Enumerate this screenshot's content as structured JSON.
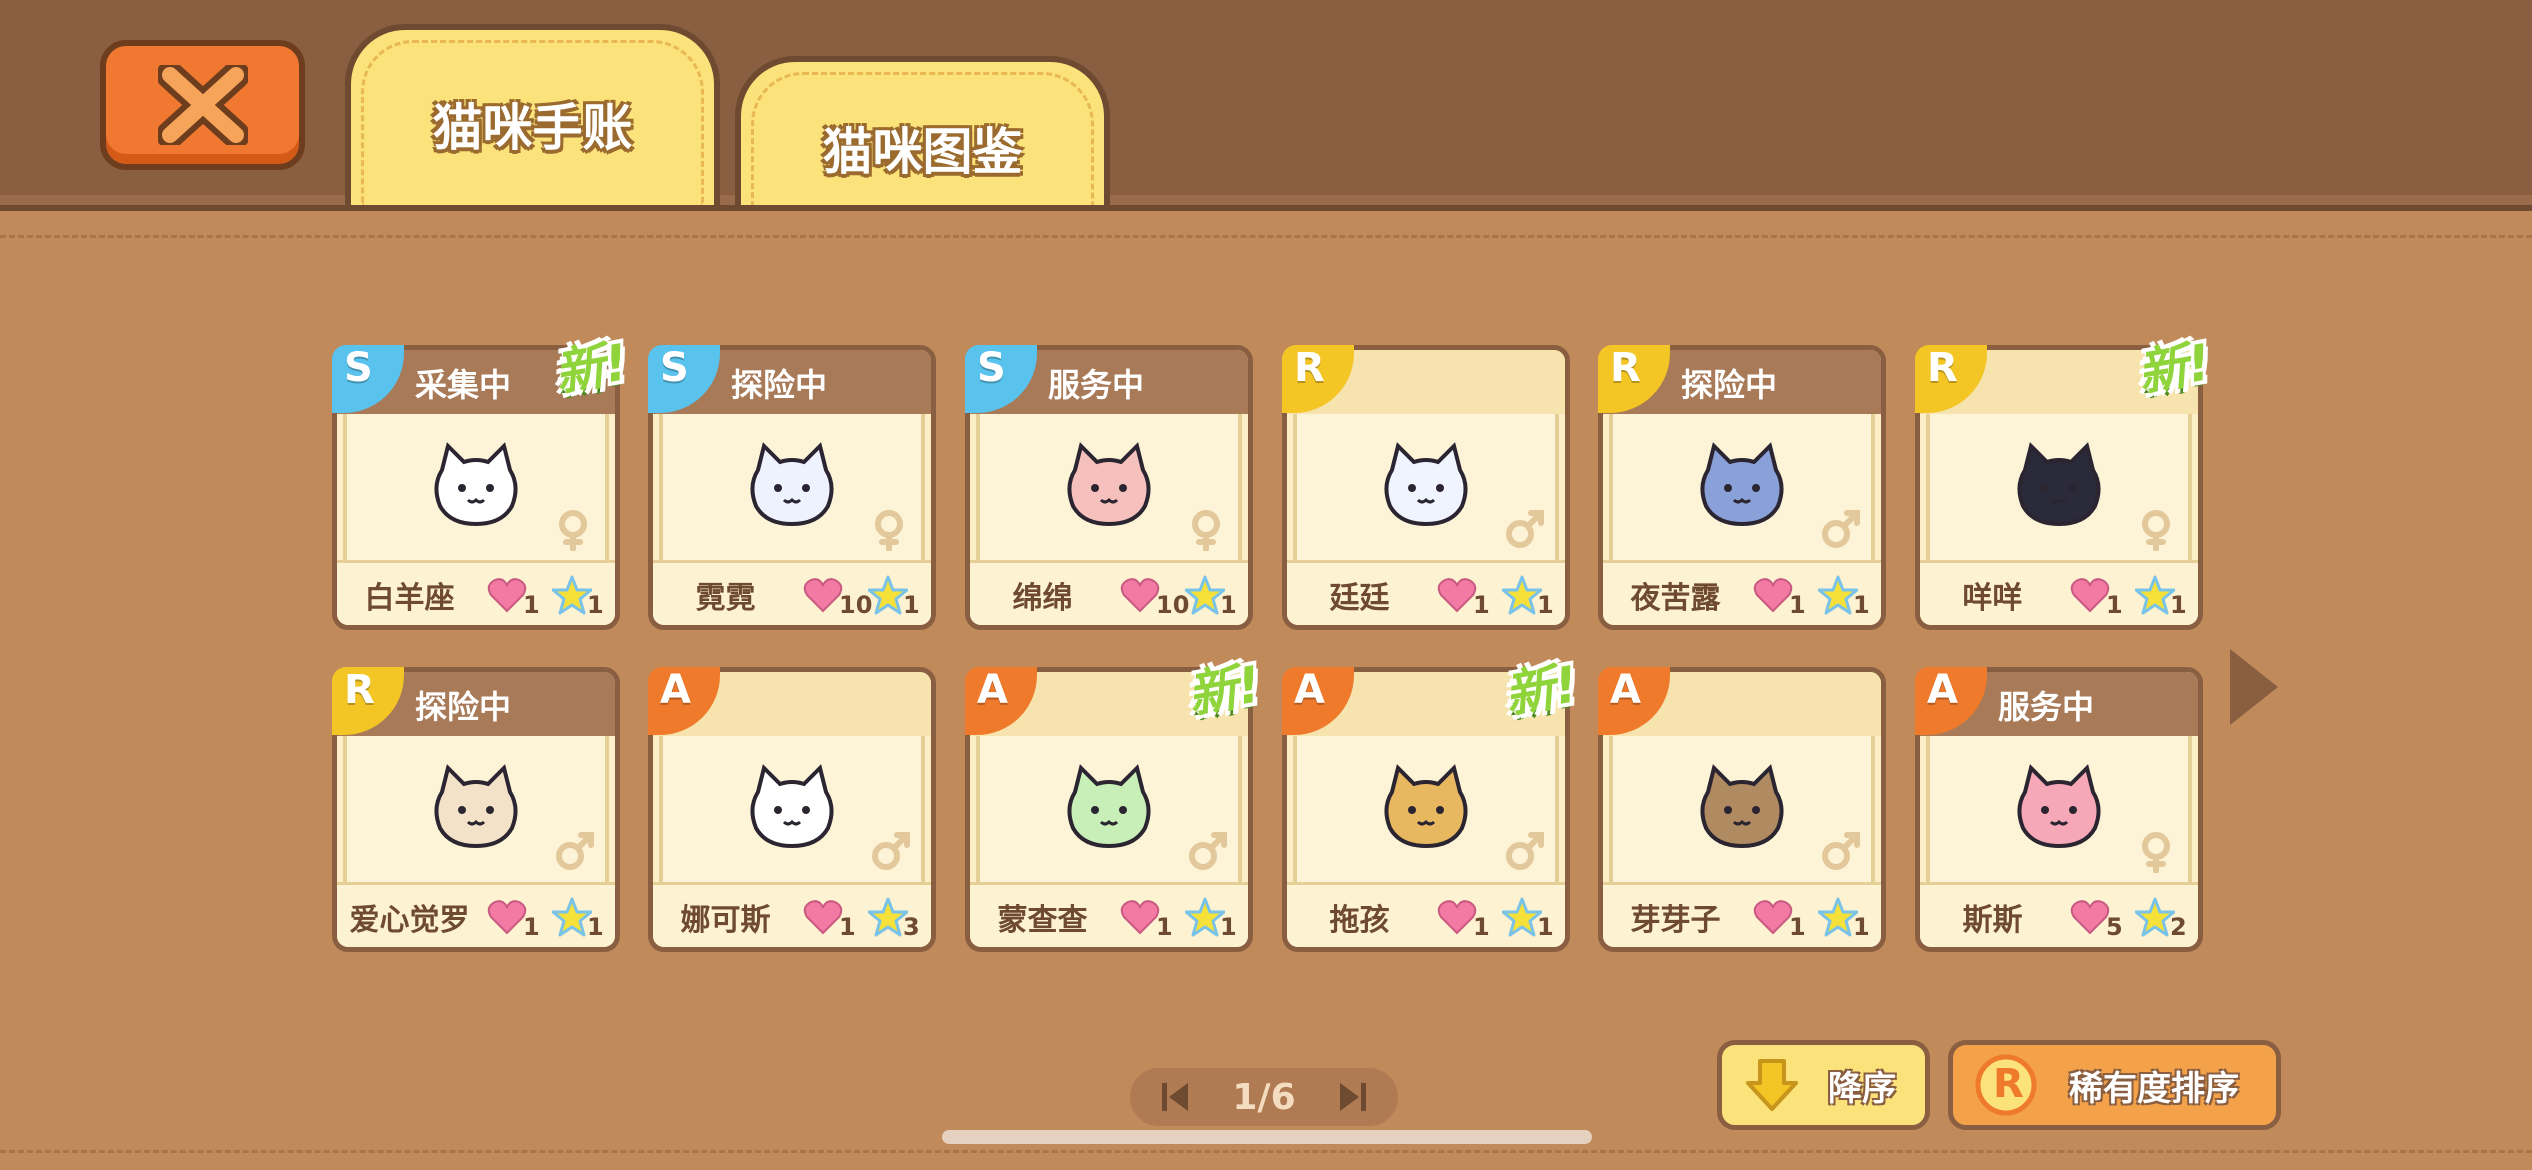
{
  "header": {
    "tabs": [
      {
        "label": "猫咪手账",
        "active": true
      },
      {
        "label": "猫咪图鉴",
        "active": false
      }
    ]
  },
  "cards": [
    {
      "rank": "S",
      "status": "采集中",
      "name": "白羊座",
      "hearts": "1",
      "stars": "1",
      "is_new": true,
      "gender": "female",
      "color": "#ffffff"
    },
    {
      "rank": "S",
      "status": "探险中",
      "name": "霓霓",
      "hearts": "10",
      "stars": "1",
      "is_new": false,
      "gender": "female",
      "color": "#eef2ff"
    },
    {
      "rank": "S",
      "status": "服务中",
      "name": "绵绵",
      "hearts": "10",
      "stars": "1",
      "is_new": false,
      "gender": "female",
      "color": "#f6c0bd"
    },
    {
      "rank": "R",
      "status": "",
      "name": "廷廷",
      "hearts": "1",
      "stars": "1",
      "is_new": false,
      "gender": "male",
      "color": "#f0f4ff"
    },
    {
      "rank": "R",
      "status": "探险中",
      "name": "夜苦露",
      "hearts": "1",
      "stars": "1",
      "is_new": false,
      "gender": "male",
      "color": "#8aa0d8"
    },
    {
      "rank": "R",
      "status": "",
      "name": "咩咩",
      "hearts": "1",
      "stars": "1",
      "is_new": true,
      "gender": "female",
      "color": "#2a2a3a"
    },
    {
      "rank": "R",
      "status": "探险中",
      "name": "爱心觉罗",
      "hearts": "1",
      "stars": "1",
      "is_new": false,
      "gender": "male",
      "color": "#f4e2c8"
    },
    {
      "rank": "A",
      "status": "",
      "name": "娜可斯",
      "hearts": "1",
      "stars": "3",
      "is_new": false,
      "gender": "male",
      "color": "#ffffff"
    },
    {
      "rank": "A",
      "status": "",
      "name": "蒙查查",
      "hearts": "1",
      "stars": "1",
      "is_new": true,
      "gender": "male",
      "color": "#c8efb8"
    },
    {
      "rank": "A",
      "status": "",
      "name": "拖孩",
      "hearts": "1",
      "stars": "1",
      "is_new": true,
      "gender": "male",
      "color": "#e8b860"
    },
    {
      "rank": "A",
      "status": "",
      "name": "芽芽子",
      "hearts": "1",
      "stars": "1",
      "is_new": false,
      "gender": "male",
      "color": "#b08a60"
    },
    {
      "rank": "A",
      "status": "服务中",
      "name": "斯斯",
      "hearts": "5",
      "stars": "2",
      "is_new": false,
      "gender": "female",
      "color": "#f6a8b8"
    }
  ],
  "new_label": "新!",
  "pagination": {
    "text": "1/6"
  },
  "sort": {
    "order_label": "降序",
    "rarity_label": "稀有度排序",
    "rarity_icon_letter": "R"
  },
  "icons": [
    "close-icon",
    "heart-icon",
    "star-icon",
    "male-icon",
    "female-icon",
    "arrow-right-icon",
    "first-page-icon",
    "last-page-icon",
    "down-arrow-icon"
  ]
}
